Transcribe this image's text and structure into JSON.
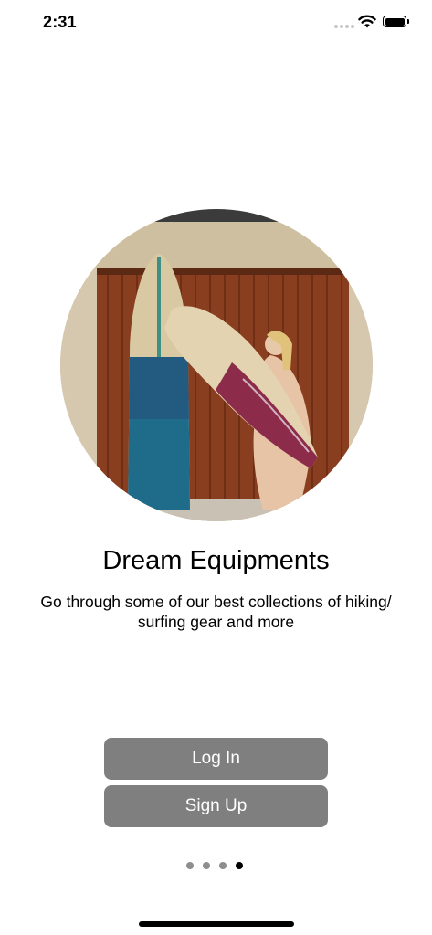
{
  "status_bar": {
    "time": "2:31",
    "icons": [
      "signal-dots-icon",
      "wifi-icon",
      "battery-icon"
    ]
  },
  "onboarding": {
    "image": "surfboards-photo",
    "title": "Dream Equipments",
    "subtitle": "Go through some of our best collections of hiking/ surfing gear and more",
    "login_label": "Log In",
    "signup_label": "Sign Up",
    "page_count": 4,
    "current_page": 4
  },
  "colors": {
    "button_bg": "#7f7f7f",
    "button_text": "#ffffff",
    "dot_inactive": "#8e8e8e",
    "dot_active": "#000000"
  }
}
